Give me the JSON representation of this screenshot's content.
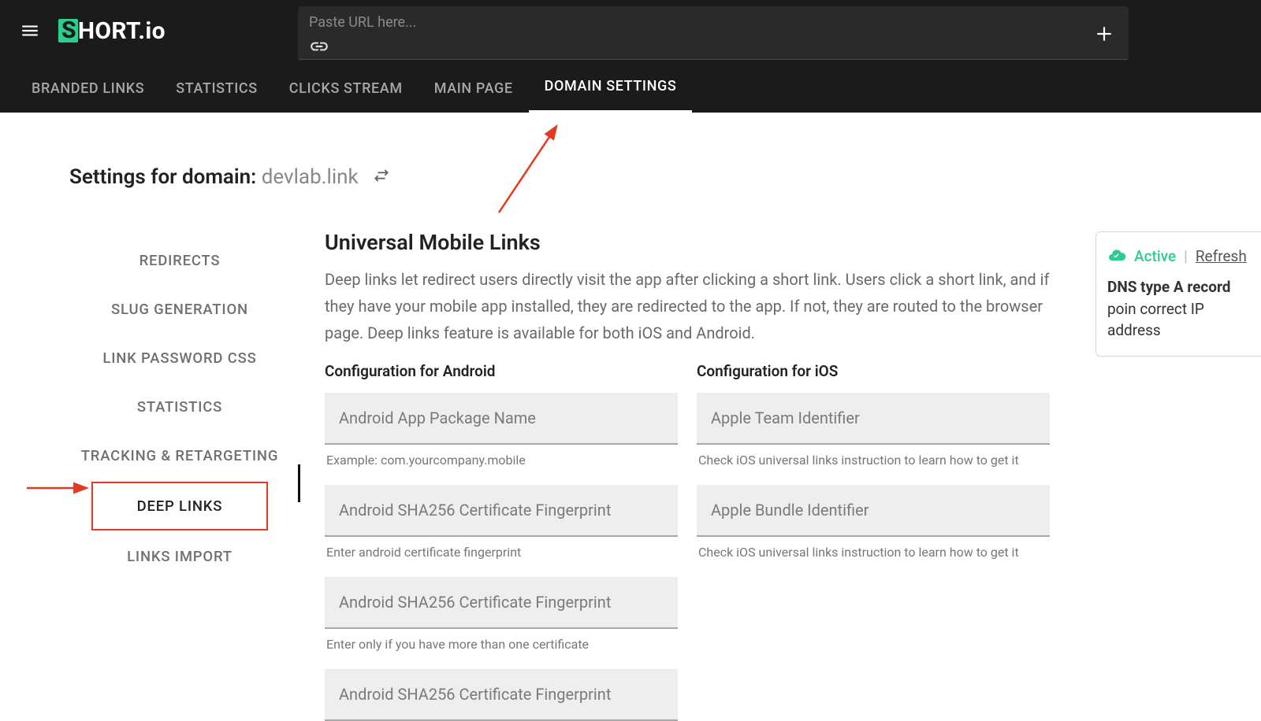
{
  "topbar": {
    "url_placeholder": "Paste URL here...",
    "logo_text": "HORT.io",
    "tabs": [
      {
        "label": "BRANDED LINKS",
        "active": false
      },
      {
        "label": "STATISTICS",
        "active": false
      },
      {
        "label": "CLICKS STREAM",
        "active": false
      },
      {
        "label": "MAIN PAGE",
        "active": false
      },
      {
        "label": "DOMAIN SETTINGS",
        "active": true
      }
    ]
  },
  "page": {
    "title_prefix": "Settings for domain: ",
    "domain": "devlab.link"
  },
  "sidebar": {
    "items": [
      {
        "label": "REDIRECTS"
      },
      {
        "label": "SLUG GENERATION"
      },
      {
        "label": "LINK PASSWORD CSS"
      },
      {
        "label": "STATISTICS"
      },
      {
        "label": "TRACKING & RETARGETING"
      },
      {
        "label": "DEEP LINKS",
        "selected": true
      },
      {
        "label": "LINKS IMPORT"
      }
    ]
  },
  "main": {
    "heading": "Universal Mobile Links",
    "description": "Deep links let redirect users directly visit the app after clicking a short link. Users click a short link, and if they have your mobile app installed, they are redirected to the app. If not, they are routed to the browser page. Deep links feature is available for both iOS and Android.",
    "android": {
      "title": "Configuration for Android",
      "fields": [
        {
          "placeholder": "Android App Package Name",
          "hint": "Example: com.yourcompany.mobile"
        },
        {
          "placeholder": "Android SHA256 Certificate Fingerprint",
          "hint": "Enter android certificate fingerprint"
        },
        {
          "placeholder": "Android SHA256 Certificate Fingerprint",
          "hint": "Enter only if you have more than one certificate"
        },
        {
          "placeholder": "Android SHA256 Certificate Fingerprint",
          "hint": ""
        }
      ]
    },
    "ios": {
      "title": "Configuration for iOS",
      "fields": [
        {
          "placeholder": "Apple Team Identifier",
          "hint": "Check iOS universal links instruction to learn how to get it"
        },
        {
          "placeholder": "Apple Bundle Identifier",
          "hint": "Check iOS universal links instruction to learn how to get it"
        }
      ]
    }
  },
  "dns": {
    "status": "Active",
    "refresh": "Refresh",
    "text_bold": "DNS type A record",
    "text_rest": " poin correct IP address"
  }
}
